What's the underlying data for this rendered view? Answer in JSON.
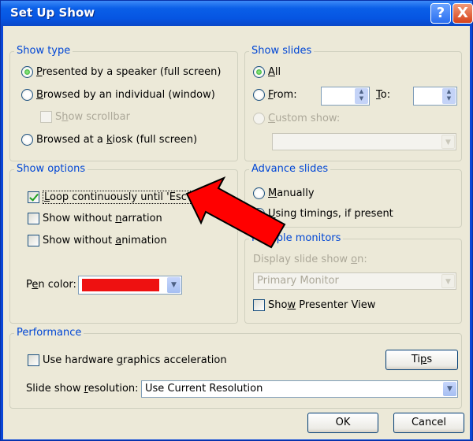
{
  "window": {
    "title": "Set Up Show",
    "help_glyph": "?",
    "close_glyph": "X"
  },
  "show_type": {
    "legend": "Show type",
    "opt_speaker": {
      "pre": "",
      "key": "P",
      "post": "resented by a speaker (full screen)",
      "selected": true
    },
    "opt_individual": {
      "pre": "",
      "key": "B",
      "post": "rowsed by an individual (window)",
      "selected": false
    },
    "show_scrollbar": {
      "pre": "S",
      "key": "h",
      "post": "ow scrollbar",
      "checked": false,
      "disabled": true
    },
    "opt_kiosk": {
      "pre": "Browsed at a ",
      "key": "k",
      "post": "iosk (full screen)",
      "selected": false
    }
  },
  "show_slides": {
    "legend": "Show slides",
    "opt_all": {
      "key": "A",
      "post": "ll",
      "selected": true
    },
    "opt_from": {
      "key": "F",
      "post": "rom:",
      "value": ""
    },
    "to_label": {
      "key": "T",
      "post": "o:",
      "value": ""
    },
    "opt_custom": {
      "key": "C",
      "post": "ustom show:",
      "disabled": true,
      "value": ""
    }
  },
  "show_options": {
    "legend": "Show options",
    "loop": {
      "key": "L",
      "post": "oop continuously until 'Esc'",
      "checked": true
    },
    "no_narration": {
      "pre": "Show without ",
      "key": "n",
      "post": "arration",
      "checked": false
    },
    "no_animation": {
      "pre": "Show without ",
      "key": "a",
      "post": "nimation",
      "checked": false
    },
    "pen_color": {
      "pre": "P",
      "key": "e",
      "post": "n color:",
      "value": "#ee1111"
    }
  },
  "advance_slides": {
    "legend": "Advance slides",
    "opt_manual": {
      "key": "M",
      "post": "anually",
      "selected": false
    },
    "opt_timings": {
      "key": "U",
      "post": "sing timings, if present",
      "selected": false
    }
  },
  "monitors": {
    "legend": "Multiple monitors",
    "display_on": {
      "pre": "Display slide show ",
      "key": "o",
      "post": "n:",
      "disabled": true
    },
    "monitor_value": "Primary Monitor",
    "presenter_view": {
      "pre": "Sho",
      "key": "w",
      "post": " Presenter View",
      "checked": false
    }
  },
  "performance": {
    "legend": "Performance",
    "hw_accel": {
      "pre": "Use hardware ",
      "key": "g",
      "post": "raphics acceleration",
      "checked": false
    },
    "tips_button": {
      "pre": "Ti",
      "key": "p",
      "post": "s"
    },
    "resolution_label": {
      "pre": "Slide show ",
      "key": "r",
      "post": "esolution:"
    },
    "resolution_value": "Use Current Resolution"
  },
  "footer": {
    "ok_label": "OK",
    "cancel_label": "Cancel"
  },
  "annotation": {
    "arrow_color": "#ff0000",
    "arrow_stroke": "#000000"
  },
  "colors": {
    "title_blue": "#0a5fe8",
    "group_legend": "#0046d5",
    "dialog_bg": "#ece9d8"
  }
}
